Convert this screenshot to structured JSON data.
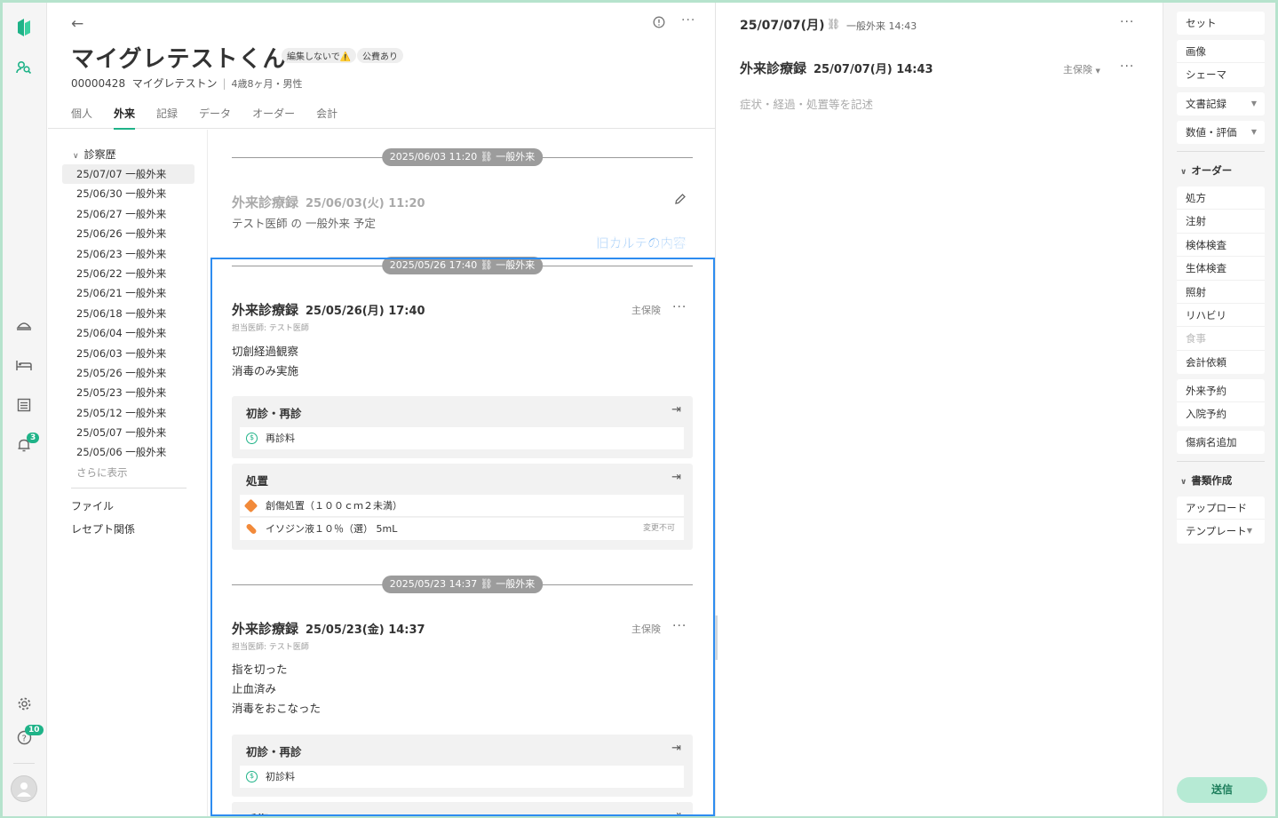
{
  "rail": {
    "bell_count": "3",
    "help_count": "10"
  },
  "patient": {
    "name": "マイグレテストくん",
    "tags": [
      "編集しないで⚠️",
      "公費あり"
    ],
    "id": "00000428",
    "kana": "マイグレテストン",
    "age_sex": "4歳8ヶ月・男性"
  },
  "tabs": [
    "個人",
    "外来",
    "記録",
    "データ",
    "オーダー",
    "会計"
  ],
  "history": {
    "heading": "診察歴",
    "items": [
      "25/07/07 一般外来",
      "25/06/30 一般外来",
      "25/06/27 一般外来",
      "25/06/26 一般外来",
      "25/06/23 一般外来",
      "25/06/22 一般外来",
      "25/06/21 一般外来",
      "25/06/18 一般外来",
      "25/06/04 一般外来",
      "25/06/03 一般外来",
      "25/05/26 一般外来",
      "25/05/23 一般外来",
      "25/05/12 一般外来",
      "25/05/07 一般外来",
      "25/05/06 一般外来"
    ],
    "more": "さらに表示",
    "links": [
      "ファイル",
      "レセプト関係"
    ]
  },
  "timeline": {
    "sep1": "2025/06/03 11:20",
    "sep1_type": "一般外来",
    "rec1_title": "外来診療録",
    "rec1_date": "25/06/03(火) 11:20",
    "rec1_note": "テスト医師 の 一般外来 予定",
    "sep2": "2025/05/26 17:40",
    "sep2_type": "一般外来",
    "rec2_title": "外来診療録",
    "rec2_date": "25/05/26(月) 17:40",
    "rec2_doctor": "担当医師: テスト医師",
    "rec2_ins": "主保険",
    "rec2_lines": [
      "切創経過観察",
      "消毒のみ実施"
    ],
    "rec2_blk1": "初診・再診",
    "rec2_blk1_row": "再診料",
    "rec2_blk2": "処置",
    "rec2_blk2_row1": "創傷処置（１００ｃｍ２未満）",
    "rec2_blk2_row2": "イソジン液１０％（選） 5mL",
    "rec2_blk2_row2_note": "変更不可",
    "sep3": "2025/05/23 14:37",
    "sep3_type": "一般外来",
    "rec3_title": "外来診療録",
    "rec3_date": "25/05/23(金) 14:37",
    "rec3_doctor": "担当医師: テスト医師",
    "rec3_ins": "主保険",
    "rec3_lines": [
      "指を切った",
      "止血済み",
      "消毒をおこなった"
    ],
    "rec3_blk1": "初診・再診",
    "rec3_blk1_row": "初診料",
    "rec3_blk2": "手術"
  },
  "overlay_label": "旧カルテの内容",
  "editor": {
    "header_date": "25/07/07(月)",
    "header_meta": "一般外来 14:43",
    "title": "外来診療録",
    "date": "25/07/07(月) 14:43",
    "insurance": "主保険",
    "placeholder": "症状・経過・処置等を記述"
  },
  "actions": {
    "set": "セット",
    "image": "画像",
    "schema": "シェーマ",
    "doc_record": "文書記録",
    "numeric_eval": "数値・評価",
    "order_heading": "オーダー",
    "orders": [
      "処方",
      "注射",
      "検体検査",
      "生体検査",
      "照射",
      "リハビリ",
      "食事",
      "会計依頼"
    ],
    "outpatient_booking": "外来予約",
    "inpatient_booking": "入院予約",
    "add_disease": "傷病名追加",
    "doc_heading": "書類作成",
    "upload": "アップロード",
    "template": "テンプレート",
    "send": "送信"
  },
  "colors": {
    "accent": "#1fb388",
    "highlight": "#2d8cf0"
  }
}
